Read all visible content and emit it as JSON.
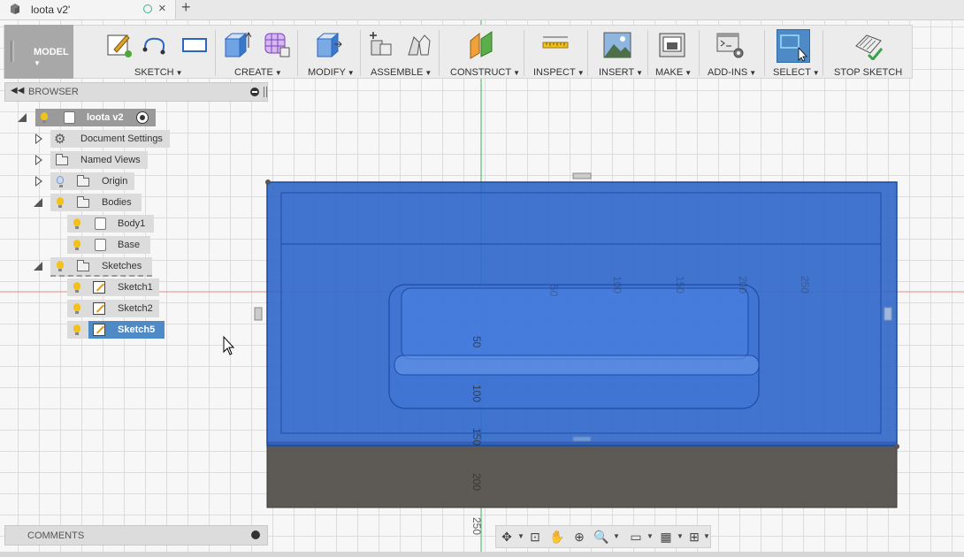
{
  "tab": {
    "title": "loota v2'",
    "new_tab": "+"
  },
  "toolbar": {
    "workspace": "MODEL",
    "groups": {
      "sketch": "SKETCH",
      "create": "CREATE",
      "modify": "MODIFY",
      "assemble": "ASSEMBLE",
      "construct": "CONSTRUCT",
      "inspect": "INSPECT",
      "insert": "INSERT",
      "make": "MAKE",
      "addins": "ADD-INS",
      "select": "SELECT",
      "stop_sketch": "STOP SKETCH"
    },
    "dropdown_glyph": "▼"
  },
  "browser": {
    "title": "BROWSER",
    "root": "loota v2",
    "items": {
      "document_settings": "Document Settings",
      "named_views": "Named Views",
      "origin": "Origin",
      "bodies": "Bodies",
      "body1": "Body1",
      "base": "Base",
      "sketches": "Sketches",
      "sketch1": "Sketch1",
      "sketch2": "Sketch2",
      "sketch5": "Sketch5"
    }
  },
  "comments": {
    "title": "COMMENTS"
  },
  "viewport": {
    "dims": [
      "50",
      "100",
      "150",
      "200",
      "250",
      "50",
      "100",
      "150",
      "200",
      "250"
    ],
    "colors": {
      "selection": "#1f5fc8",
      "base": "#555555",
      "axis_x": "#e05a5a",
      "axis_y": "#3aba5a"
    }
  }
}
